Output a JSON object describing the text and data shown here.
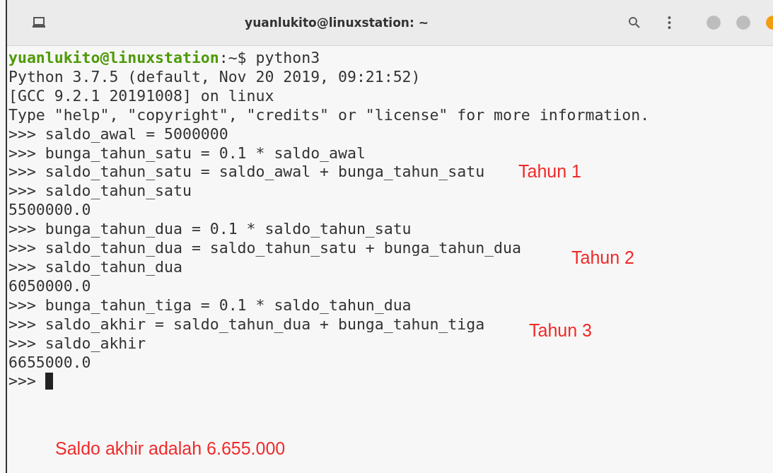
{
  "window": {
    "title": "yuanlukito@linuxstation: ~"
  },
  "terminal": {
    "prompt": {
      "user_host": "yuanlukito@linuxstation",
      "path_suffix": ":~$",
      "command": " python3"
    },
    "lines": [
      {
        "kind": "output",
        "text": "Python 3.7.5 (default, Nov 20 2019, 09:21:52)"
      },
      {
        "kind": "output",
        "text": "[GCC 9.2.1 20191008] on linux"
      },
      {
        "kind": "output",
        "text": "Type \"help\", \"copyright\", \"credits\" or \"license\" for more information."
      },
      {
        "kind": "input",
        "text": ">>> saldo_awal = 5000000"
      },
      {
        "kind": "input",
        "text": ">>> bunga_tahun_satu = 0.1 * saldo_awal"
      },
      {
        "kind": "input",
        "text": ">>> saldo_tahun_satu = saldo_awal + bunga_tahun_satu"
      },
      {
        "kind": "input",
        "text": ">>> saldo_tahun_satu"
      },
      {
        "kind": "output",
        "text": "5500000.0"
      },
      {
        "kind": "input",
        "text": ">>> bunga_tahun_dua = 0.1 * saldo_tahun_satu"
      },
      {
        "kind": "input",
        "text": ">>> saldo_tahun_dua = saldo_tahun_satu + bunga_tahun_dua"
      },
      {
        "kind": "input",
        "text": ">>> saldo_tahun_dua"
      },
      {
        "kind": "output",
        "text": "6050000.0"
      },
      {
        "kind": "input",
        "text": ">>> bunga_tahun_tiga = 0.1 * saldo_tahun_dua"
      },
      {
        "kind": "input",
        "text": ">>> saldo_akhir = saldo_tahun_dua + bunga_tahun_tiga"
      },
      {
        "kind": "input",
        "text": ">>> saldo_akhir"
      },
      {
        "kind": "output",
        "text": "6655000.0"
      },
      {
        "kind": "cursor",
        "text": ">>>"
      }
    ]
  },
  "annotations": [
    {
      "text": "Tahun 1"
    },
    {
      "text": "Tahun 2"
    },
    {
      "text": "Tahun 3"
    },
    {
      "text": "Saldo akhir adalah 6.655.000"
    }
  ]
}
